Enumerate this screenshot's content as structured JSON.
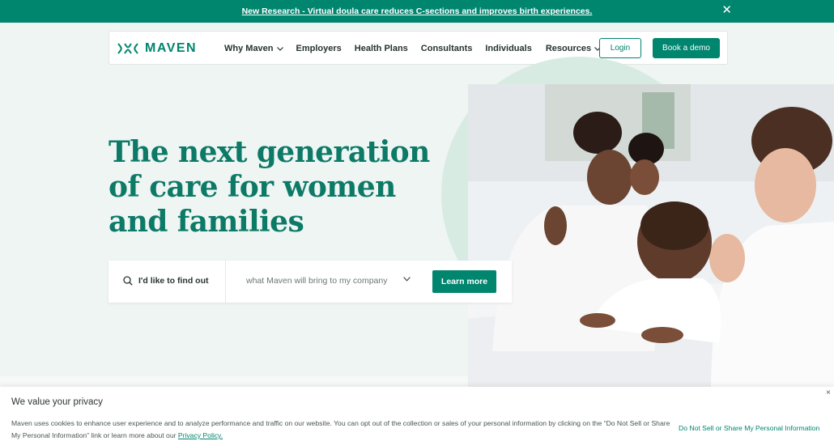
{
  "announcement": {
    "text": "New Research - Virtual doula care reduces C-sections and improves birth experiences.",
    "close_icon": "close-icon"
  },
  "nav": {
    "logo_text": "MAVEN",
    "items": [
      {
        "label": "Why Maven",
        "dropdown": true
      },
      {
        "label": "Employers",
        "dropdown": false
      },
      {
        "label": "Health Plans",
        "dropdown": false
      },
      {
        "label": "Consultants",
        "dropdown": false
      },
      {
        "label": "Individuals",
        "dropdown": false
      },
      {
        "label": "Resources",
        "dropdown": true
      }
    ],
    "login_label": "Login",
    "demo_label": "Book a demo"
  },
  "hero": {
    "title_lines": [
      "The next generation",
      "of care for women",
      "and families"
    ],
    "finder_label": "I'd like to find out",
    "finder_selected": "what Maven will bring to my company",
    "cta_label": "Learn more"
  },
  "cookie": {
    "title": "We value your privacy",
    "body": "Maven uses cookies to enhance user experience and to analyze performance and traffic on our website. You can opt out of the collection or sales of your personal information by clicking on the “Do Not Sell or Share My Personal Information” link or learn more about our ",
    "policy_link": "Privacy Policy.",
    "dns_link": "Do Not Sell or Share My Personal Information",
    "close_glyph": "×"
  },
  "colors": {
    "brand_green": "#00856f",
    "hero_bg": "#eef5f3",
    "circle": "#d8ebe2"
  }
}
